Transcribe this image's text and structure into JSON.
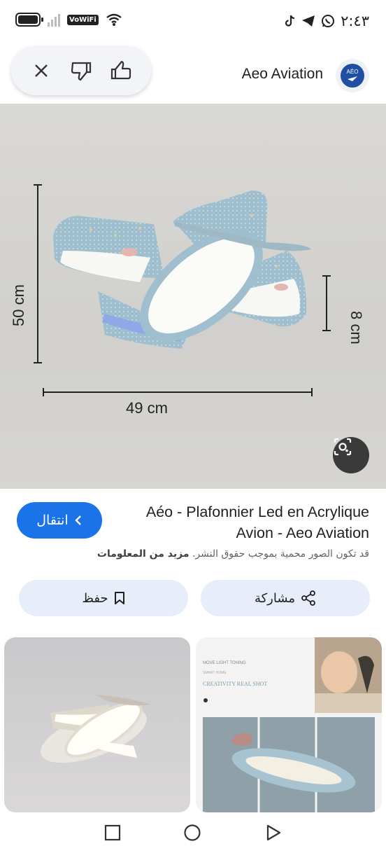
{
  "status_bar": {
    "network_badge": "VoWiFi",
    "time": "٢:٤٣"
  },
  "header": {
    "site_name": "Aeo Aviation",
    "logo_text": "AÉO"
  },
  "image": {
    "dimension_height": "50 cm",
    "dimension_depth": "8 cm",
    "dimension_width": "49 cm"
  },
  "result": {
    "visit_label": "انتقال",
    "title": "Aéo - Plafonnier Led en Acrylique Avion - Aeo Aviation",
    "copyright_text": "قد تكون الصور محمية بموجب حقوق النشر.",
    "more_info_link": "مزيد من المعلومات"
  },
  "actions": {
    "save_label": "حفظ",
    "share_label": "مشاركة"
  },
  "related": {
    "card2_heading1": "MOVE LIGHT TONING",
    "card2_heading2": "SMART HOME",
    "card2_heading3": "CREATIVITY REAL SHOT"
  },
  "colors": {
    "accent": "#1a73e8",
    "button_bg": "#e8eef9"
  }
}
